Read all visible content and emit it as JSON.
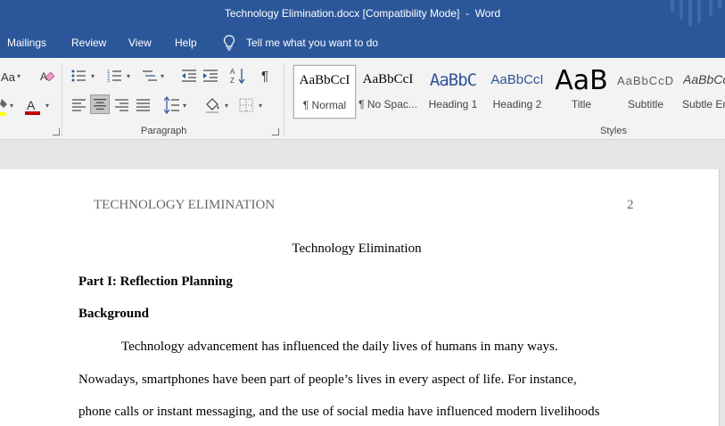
{
  "window": {
    "doc_name": "Technology Elimination.docx",
    "mode": "[Compatibility Mode]",
    "separator": "-",
    "app": "Word"
  },
  "tabs": [
    "Mailings",
    "Review",
    "View",
    "Help"
  ],
  "tell_me": "Tell me what you want to do",
  "ribbon": {
    "font_group": {
      "change_case": "Aa"
    },
    "paragraph_group": {
      "label": "Paragraph"
    },
    "styles_group": {
      "label": "Styles",
      "items": [
        {
          "sample": "AaBbCcI",
          "name": "¶ Normal"
        },
        {
          "sample": "AaBbCcI",
          "name": "¶ No Spac..."
        },
        {
          "sample": "AaBbC",
          "name": "Heading 1"
        },
        {
          "sample": "AaBbCcI",
          "name": "Heading 2"
        },
        {
          "sample": "AaB",
          "name": "Title"
        },
        {
          "sample": "AaBbCcD",
          "name": "Subtitle"
        },
        {
          "sample": "AaBbCcI",
          "name": "Subtle Em"
        }
      ],
      "selected": "¶ Normal"
    }
  },
  "colors": {
    "brand": "#2b579a",
    "font_color_bar": "#c00000",
    "highlight_bar": "#ffff00",
    "heading_sample": "#2f5496"
  },
  "icons": {
    "tell_me": "lightbulb-icon",
    "clear_formatting": "eraser-icon",
    "bullets": "bullets-icon",
    "numbering": "numbering-icon",
    "multilevel": "multilevel-list-icon",
    "decrease_indent": "decrease-indent-icon",
    "increase_indent": "increase-indent-icon",
    "sort": "sort-icon",
    "show_marks": "pilcrow-icon",
    "align_left": "align-left-icon",
    "align_center": "align-center-icon",
    "align_right": "align-right-icon",
    "justify": "justify-icon",
    "line_spacing": "line-spacing-icon",
    "shading": "shading-icon",
    "borders": "borders-icon"
  },
  "document": {
    "header_left": "TECHNOLOGY ELIMINATION",
    "page_number": "2",
    "title": "Technology Elimination",
    "headings": [
      "Part I: Reflection Planning",
      "Background"
    ],
    "paragraph_lines": [
      "Technology advancement has influenced the daily lives of humans in many ways.",
      "Nowadays, smartphones have been part of people’s lives in every aspect of life. For instance,",
      "phone calls or instant messaging, and the use of social media have influenced modern livelihoods"
    ]
  }
}
